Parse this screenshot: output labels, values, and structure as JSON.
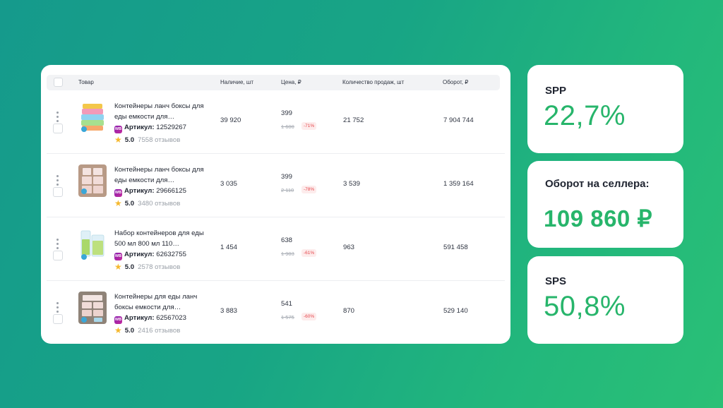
{
  "table": {
    "headers": {
      "product": "Товар",
      "stock": "Наличие, шт",
      "price": "Цена, ₽",
      "sales": "Количество продаж, шт",
      "revenue": "Оборот, ₽"
    },
    "sku_label": "Артикул:",
    "marketplace_badge": "WB",
    "rows": [
      {
        "name": "Контейнеры ланч боксы для еды емкости для…",
        "sku": "12529267",
        "rating": "5.0",
        "reviews": "7558 отзывов",
        "stock": "39 920",
        "price": "399",
        "old_price": "1 600",
        "discount": "-71%",
        "sales": "21 752",
        "revenue": "7 904 744"
      },
      {
        "name": "Контейнеры ланч боксы для еды емкости для…",
        "sku": "29666125",
        "rating": "5.0",
        "reviews": "3480 отзывов",
        "stock": "3 035",
        "price": "399",
        "old_price": "2 110",
        "discount": "-78%",
        "sales": "3 539",
        "revenue": "1 359 164"
      },
      {
        "name": "Набор контейнеров для еды 500 мл 800 мл 110…",
        "sku": "62632755",
        "rating": "5.0",
        "reviews": "2578 отзывов",
        "stock": "1 454",
        "price": "638",
        "old_price": "1 903",
        "discount": "-61%",
        "sales": "963",
        "revenue": "591 458"
      },
      {
        "name": "Контейнеры для еды ланч боксы емкости для…",
        "sku": "62567023",
        "rating": "5.0",
        "reviews": "2416 отзывов",
        "stock": "3 883",
        "price": "541",
        "old_price": "1 575",
        "discount": "-60%",
        "sales": "870",
        "revenue": "529 140"
      }
    ]
  },
  "stats": [
    {
      "label": "SPP",
      "value": "22,7%"
    },
    {
      "label": "Оборот на селлера:",
      "value": "109 860 ₽"
    },
    {
      "label": "SPS",
      "value": "50,8%"
    }
  ],
  "colors": {
    "accent_green": "#27b56b",
    "discount_red": "#e5484d",
    "star": "#f5b82e",
    "background_start": "#159a8c",
    "background_end": "#2ac076"
  }
}
